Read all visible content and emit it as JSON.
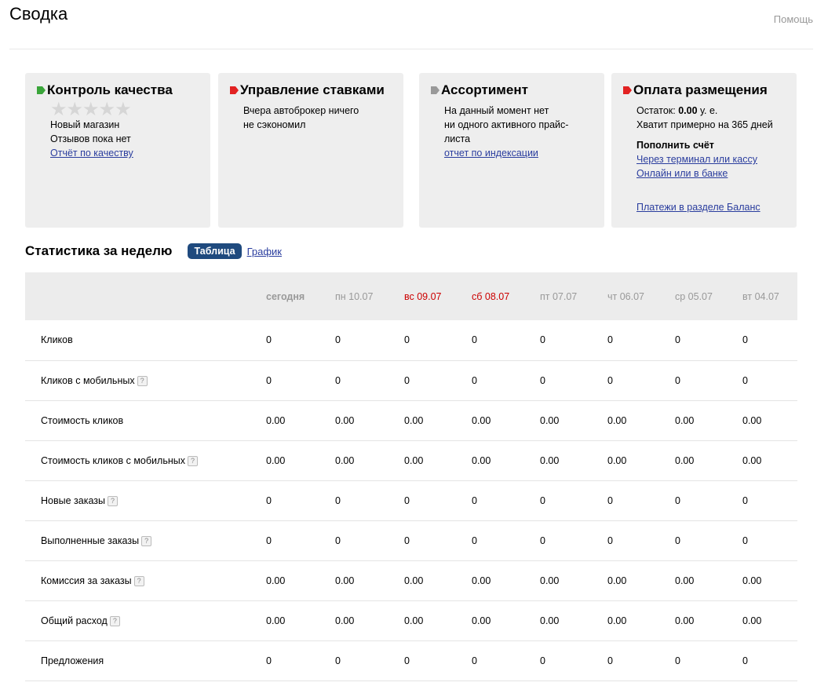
{
  "header": {
    "title": "Сводка",
    "help": "Помощь"
  },
  "cards": [
    {
      "title": "Контроль качества",
      "flag_color": "#3aa53a",
      "rating_stars": 0,
      "rating_max": 5,
      "lines": [
        "Новый магазин",
        "Отзывов пока нет"
      ],
      "link": "Отчёт по качеству"
    },
    {
      "title": "Управление ставками",
      "flag_color": "#e22222",
      "lines": [
        "Вчера автоброкер ничего",
        "не сэкономил"
      ]
    },
    {
      "title": "Ассортимент",
      "flag_color": "#999999",
      "lines": [
        "На данный момент нет",
        "ни одного активного прайс-",
        "листа"
      ],
      "link": "отчет по индексации"
    },
    {
      "title": "Оплата размещения",
      "flag_color": "#e22222",
      "balance_prefix": "Остаток: ",
      "balance_value": "0.00",
      "balance_suffix": " у. е.",
      "days_line": "Хватит примерно на 365 дней",
      "topup_title": "Пополнить счёт",
      "topup_links": [
        "Через терминал или кассу",
        "Онлайн или в банке"
      ],
      "bottom_link": "Платежи в разделе Баланс"
    }
  ],
  "stats": {
    "title": "Статистика за неделю",
    "tab_active": "Таблица",
    "tab_other": "График",
    "columns": [
      "сегодня",
      "пн 10.07",
      "вс 09.07",
      "сб 08.07",
      "пт 07.07",
      "чт 06.07",
      "ср 05.07",
      "вт 04.07"
    ],
    "weekend_color": "#cc0000",
    "rows": [
      {
        "label": "Кликов",
        "help": false,
        "values": [
          "0",
          "0",
          "0",
          "0",
          "0",
          "0",
          "0",
          "0"
        ]
      },
      {
        "label": "Кликов с мобильных",
        "help": true,
        "values": [
          "0",
          "0",
          "0",
          "0",
          "0",
          "0",
          "0",
          "0"
        ]
      },
      {
        "label": "Стоимость кликов",
        "help": false,
        "values": [
          "0.00",
          "0.00",
          "0.00",
          "0.00",
          "0.00",
          "0.00",
          "0.00",
          "0.00"
        ]
      },
      {
        "label": "Стоимость кликов с мобильных",
        "help": true,
        "values": [
          "0.00",
          "0.00",
          "0.00",
          "0.00",
          "0.00",
          "0.00",
          "0.00",
          "0.00"
        ]
      },
      {
        "label": "Новые заказы",
        "help": true,
        "values": [
          "0",
          "0",
          "0",
          "0",
          "0",
          "0",
          "0",
          "0"
        ]
      },
      {
        "label": "Выполненные заказы",
        "help": true,
        "values": [
          "0",
          "0",
          "0",
          "0",
          "0",
          "0",
          "0",
          "0"
        ]
      },
      {
        "label": "Комиссия за заказы",
        "help": true,
        "values": [
          "0.00",
          "0.00",
          "0.00",
          "0.00",
          "0.00",
          "0.00",
          "0.00",
          "0.00"
        ]
      },
      {
        "label": "Общий расход",
        "help": true,
        "values": [
          "0.00",
          "0.00",
          "0.00",
          "0.00",
          "0.00",
          "0.00",
          "0.00",
          "0.00"
        ]
      },
      {
        "label": "Предложения",
        "help": false,
        "values": [
          "0",
          "0",
          "0",
          "0",
          "0",
          "0",
          "0",
          "0"
        ]
      }
    ],
    "help_glyph": "?"
  }
}
